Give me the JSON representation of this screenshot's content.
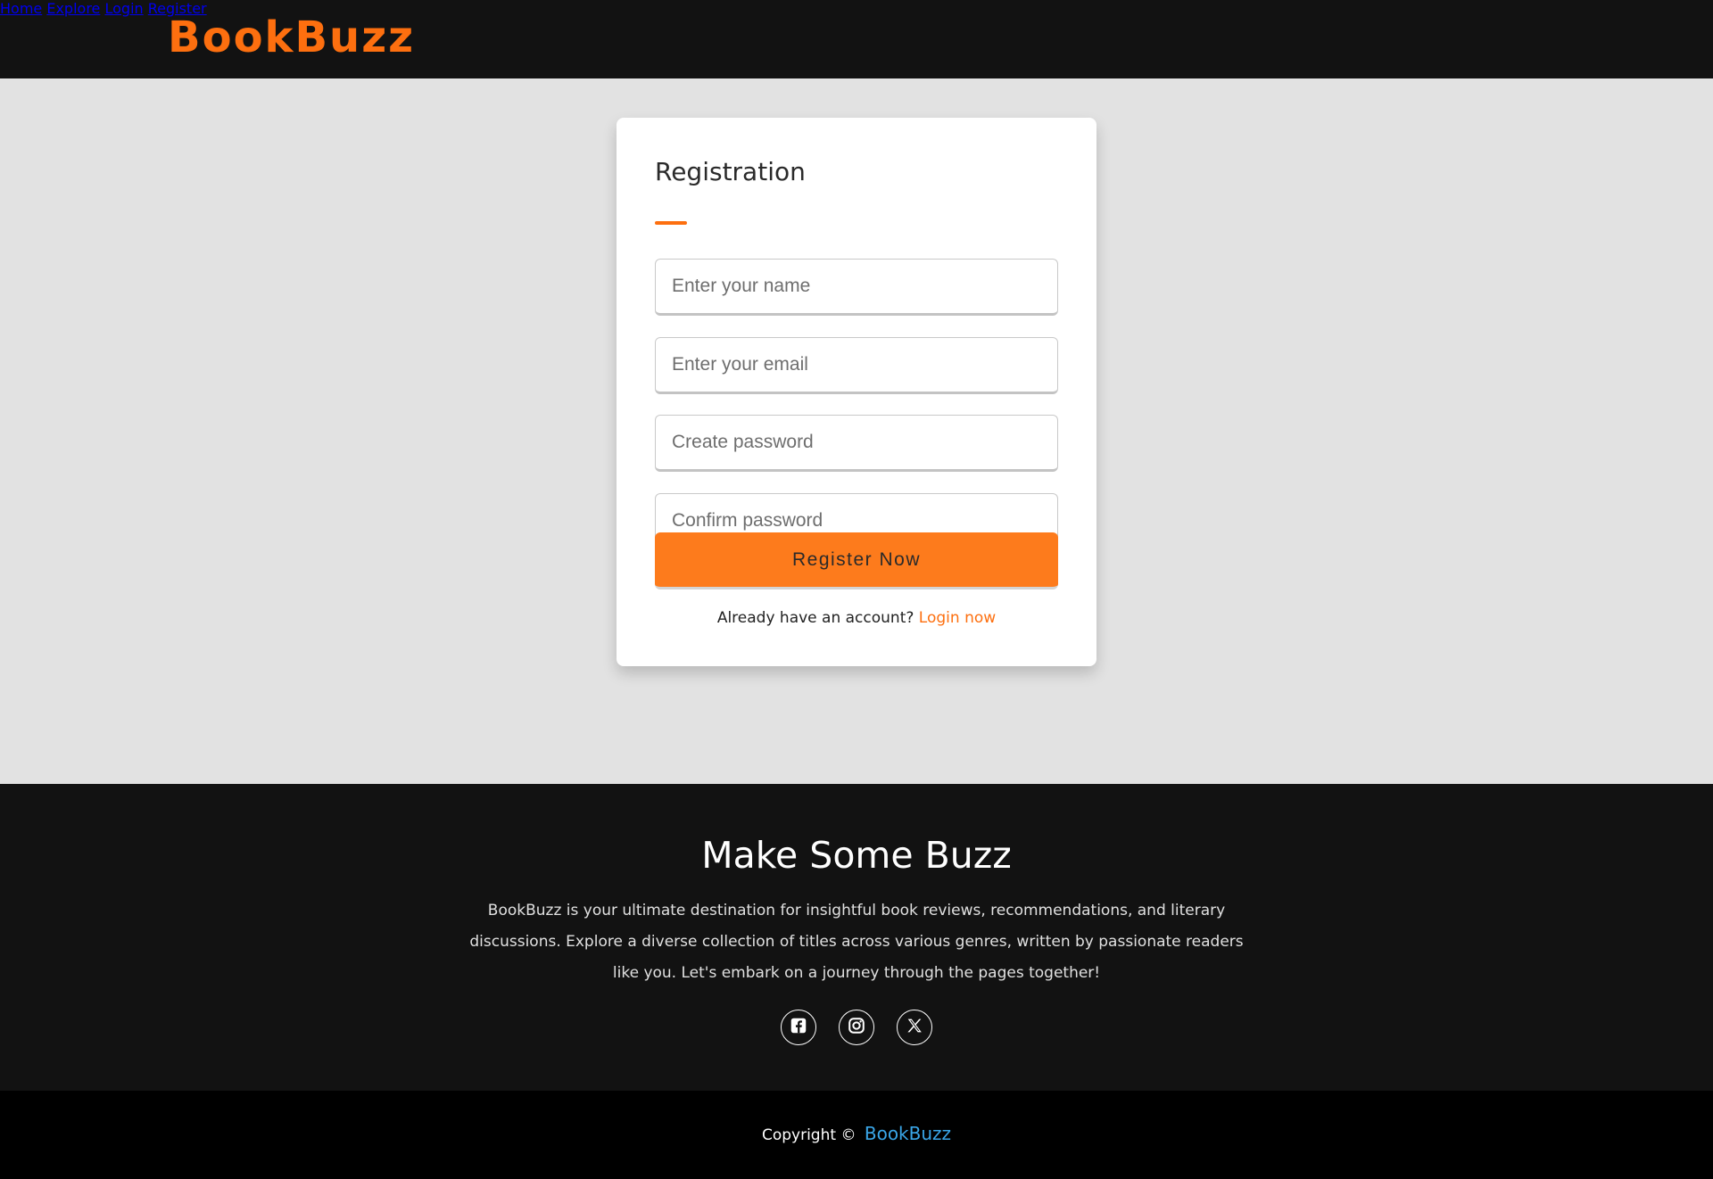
{
  "header": {
    "logo": "BookBuzz",
    "nav": [
      {
        "label": "Home"
      },
      {
        "label": "Explore"
      },
      {
        "label": "Login"
      },
      {
        "label": "Register"
      }
    ]
  },
  "form": {
    "title": "Registration",
    "name_placeholder": "Enter your name",
    "email_placeholder": "Enter your email",
    "password_placeholder": "Create password",
    "confirm_placeholder": "Confirm password",
    "submit_label": "Register Now",
    "already_text": "Already have an account?",
    "login_link": "Login now"
  },
  "footer": {
    "title": "Make Some Buzz",
    "description": "BookBuzz is your ultimate destination for insightful book reviews, recommendations, and literary discussions. Explore a diverse collection of titles across various genres, written by passionate readers like you. Let's embark on a journey through the pages together!",
    "socials": [
      {
        "icon": "facebook-icon"
      },
      {
        "icon": "instagram-icon"
      },
      {
        "icon": "x-twitter-icon"
      }
    ],
    "copyright_text": "Copyright ©",
    "copyright_brand": "BookBuzz"
  },
  "colors": {
    "accent": "#fd6f0f",
    "button": "#fd7b1c",
    "header_bg": "#121212",
    "page_bg": "#e2e2e2",
    "link_blue": "#3aa6e8"
  }
}
